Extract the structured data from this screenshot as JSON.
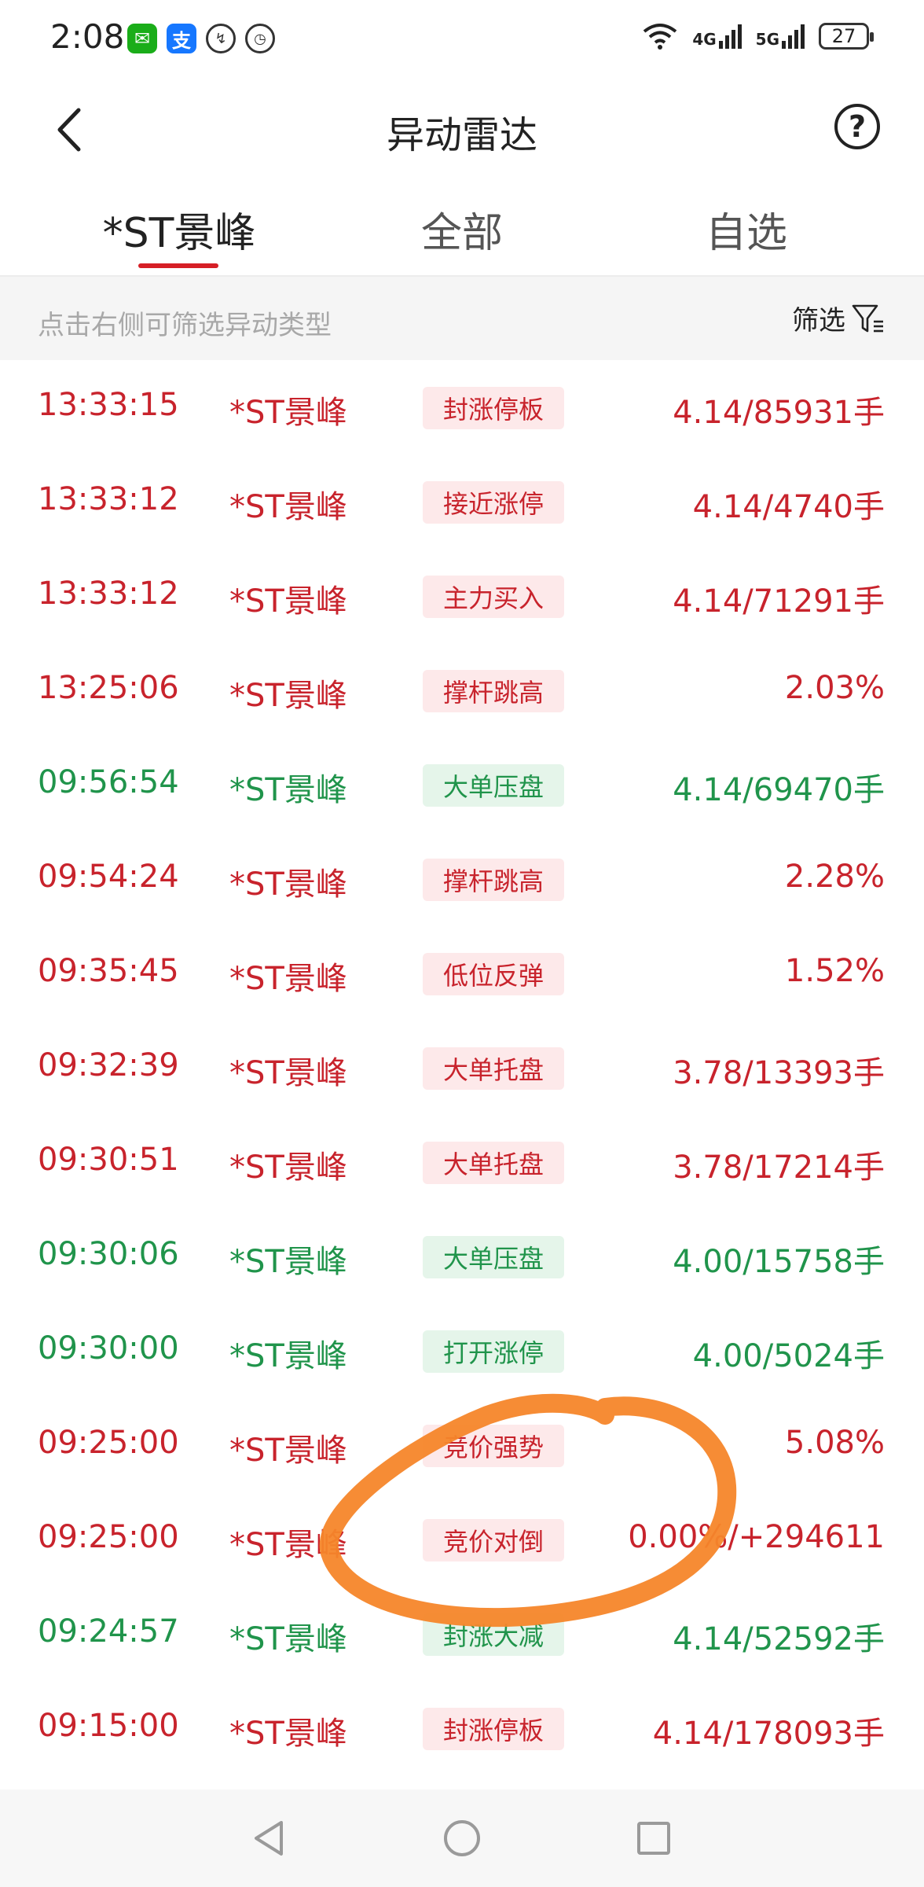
{
  "status": {
    "time": "2:08",
    "apps": [
      {
        "icon": "wechat-icon",
        "glyph": "✉",
        "color": "#1aad19"
      },
      {
        "icon": "alipay-icon",
        "glyph": "支",
        "color": "#1677ff"
      }
    ],
    "net1": "4G",
    "net2": "5G",
    "battery": "27"
  },
  "header": {
    "title": "异动雷达"
  },
  "tabs": [
    {
      "label": "*ST景峰",
      "active": true
    },
    {
      "label": "全部",
      "active": false
    },
    {
      "label": "自选",
      "active": false
    }
  ],
  "filter": {
    "hint": "点击右侧可筛选异动类型",
    "button_label": "筛选"
  },
  "colors": {
    "up": "#c8232c",
    "down": "#20944b",
    "accent": "#d61f26",
    "annotation": "#f5862a"
  },
  "rows": [
    {
      "time": "13:33:15",
      "name": "*ST景峰",
      "tag": "封涨停板",
      "value": "4.14/85931手",
      "dir": "up"
    },
    {
      "time": "13:33:12",
      "name": "*ST景峰",
      "tag": "接近涨停",
      "value": "4.14/4740手",
      "dir": "up"
    },
    {
      "time": "13:33:12",
      "name": "*ST景峰",
      "tag": "主力买入",
      "value": "4.14/71291手",
      "dir": "up"
    },
    {
      "time": "13:25:06",
      "name": "*ST景峰",
      "tag": "撑杆跳高",
      "value": "2.03%",
      "dir": "up"
    },
    {
      "time": "09:56:54",
      "name": "*ST景峰",
      "tag": "大单压盘",
      "value": "4.14/69470手",
      "dir": "down"
    },
    {
      "time": "09:54:24",
      "name": "*ST景峰",
      "tag": "撑杆跳高",
      "value": "2.28%",
      "dir": "up"
    },
    {
      "time": "09:35:45",
      "name": "*ST景峰",
      "tag": "低位反弹",
      "value": "1.52%",
      "dir": "up"
    },
    {
      "time": "09:32:39",
      "name": "*ST景峰",
      "tag": "大单托盘",
      "value": "3.78/13393手",
      "dir": "up"
    },
    {
      "time": "09:30:51",
      "name": "*ST景峰",
      "tag": "大单托盘",
      "value": "3.78/17214手",
      "dir": "up"
    },
    {
      "time": "09:30:06",
      "name": "*ST景峰",
      "tag": "大单压盘",
      "value": "4.00/15758手",
      "dir": "down"
    },
    {
      "time": "09:30:00",
      "name": "*ST景峰",
      "tag": "打开涨停",
      "value": "4.00/5024手",
      "dir": "down"
    },
    {
      "time": "09:25:00",
      "name": "*ST景峰",
      "tag": "竞价强势",
      "value": "5.08%",
      "dir": "up"
    },
    {
      "time": "09:25:00",
      "name": "*ST景峰",
      "tag": "竞价对倒",
      "value": "0.00%/+294611",
      "dir": "up"
    },
    {
      "time": "09:24:57",
      "name": "*ST景峰",
      "tag": "封涨大减",
      "value": "4.14/52592手",
      "dir": "down"
    },
    {
      "time": "09:15:00",
      "name": "*ST景峰",
      "tag": "封涨停板",
      "value": "4.14/178093手",
      "dir": "up"
    }
  ],
  "navbar": {
    "back": "nav-back-icon",
    "home": "nav-home-icon",
    "recents": "nav-recents-icon"
  }
}
